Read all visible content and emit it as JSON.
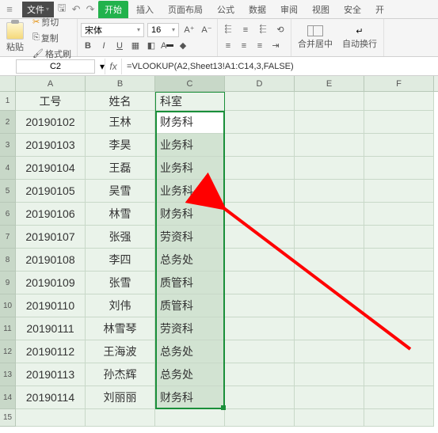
{
  "menu": {
    "file": "文件",
    "tabs": [
      "开始",
      "插入",
      "页面布局",
      "公式",
      "数据",
      "审阅",
      "视图",
      "安全",
      "开"
    ]
  },
  "ribbon": {
    "paste": "粘贴",
    "cut": "剪切",
    "copy": "复制",
    "format_painter": "格式刷",
    "font": "宋体",
    "size": "16",
    "merge": "合并居中",
    "wrap": "自动换行"
  },
  "namebox": "C2",
  "formula": "=VLOOKUP(A2,Sheet13!A1:C14,3,FALSE)",
  "columns": [
    "A",
    "B",
    "C",
    "D",
    "E",
    "F"
  ],
  "headers": [
    "工号",
    "姓名",
    "科室"
  ],
  "rows": [
    {
      "c1": "20190102",
      "c2": "王林",
      "c3": "财务科"
    },
    {
      "c1": "20190103",
      "c2": "李昊",
      "c3": "业务科"
    },
    {
      "c1": "20190104",
      "c2": "王磊",
      "c3": "业务科"
    },
    {
      "c1": "20190105",
      "c2": "吴雪",
      "c3": "业务科"
    },
    {
      "c1": "20190106",
      "c2": "林雪",
      "c3": "财务科"
    },
    {
      "c1": "20190107",
      "c2": "张强",
      "c3": "劳资科"
    },
    {
      "c1": "20190108",
      "c2": "李四",
      "c3": "总务处"
    },
    {
      "c1": "20190109",
      "c2": "张雪",
      "c3": "质管科"
    },
    {
      "c1": "20190110",
      "c2": "刘伟",
      "c3": "质管科"
    },
    {
      "c1": "20190111",
      "c2": "林雪琴",
      "c3": "劳资科"
    },
    {
      "c1": "20190112",
      "c2": "王海波",
      "c3": "总务处"
    },
    {
      "c1": "20190113",
      "c2": "孙杰辉",
      "c3": "总务处"
    },
    {
      "c1": "20190114",
      "c2": "刘丽丽",
      "c3": "财务科"
    }
  ]
}
